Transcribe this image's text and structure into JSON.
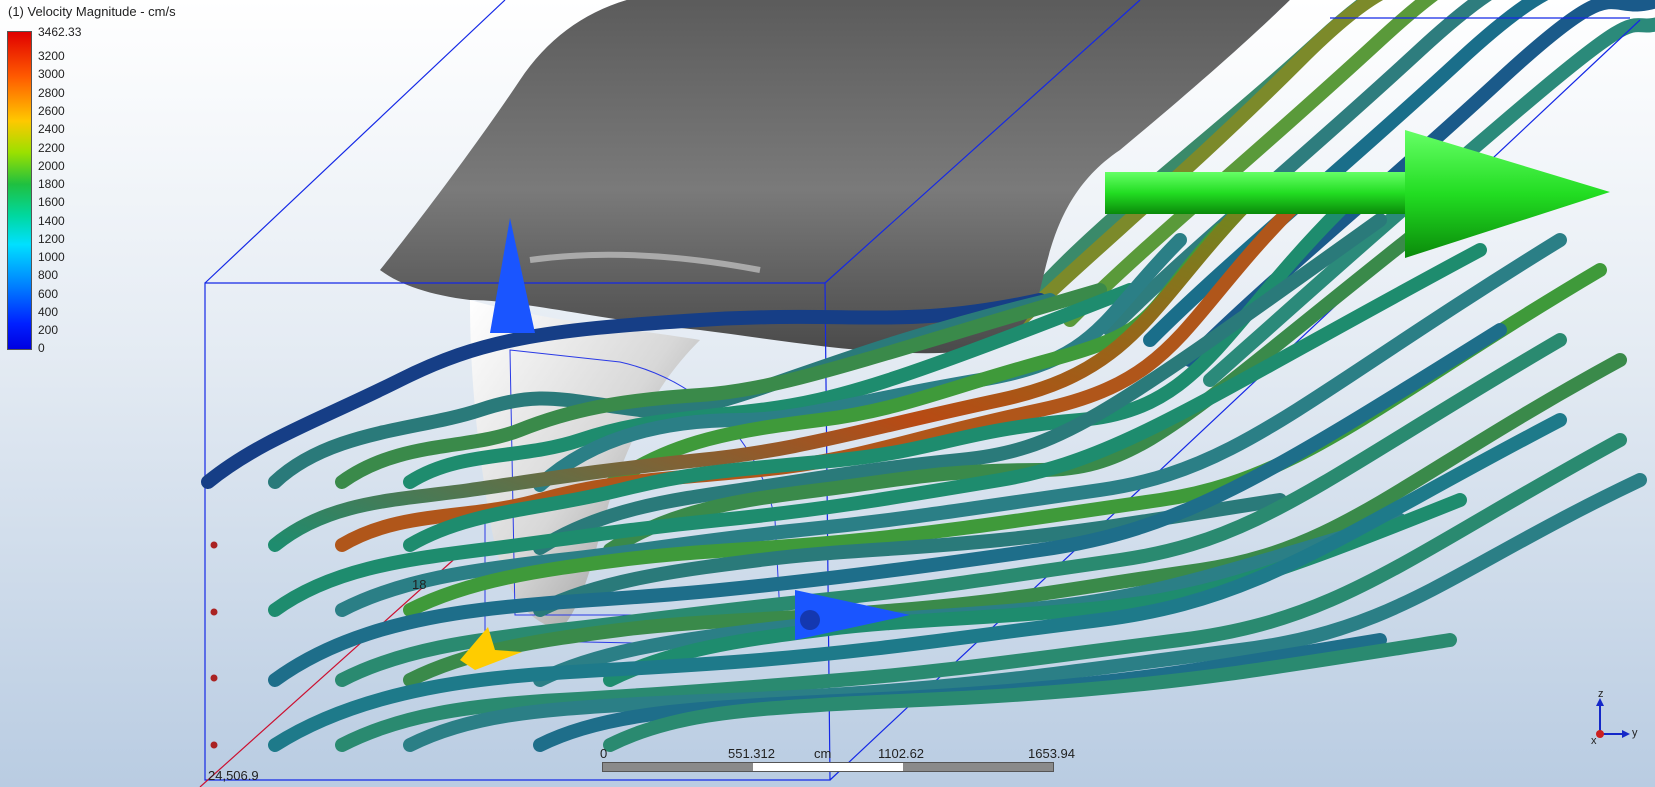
{
  "legend": {
    "title": "(1) Velocity Magnitude - cm/s",
    "max_label": "3462.33",
    "ticks": [
      "3200",
      "3000",
      "2800",
      "2600",
      "2400",
      "2200",
      "2000",
      "1800",
      "1600",
      "1400",
      "1200",
      "1000",
      "800",
      "600",
      "400",
      "200",
      "0"
    ]
  },
  "scale_bar": {
    "labels": [
      "0",
      "551.312",
      "cm",
      "1102.62",
      "1653.94"
    ]
  },
  "viewport_labels": {
    "bottom_left": "24,506.9",
    "axis_tick": "18"
  },
  "triad": {
    "z": "z",
    "y": "y",
    "x": "x"
  },
  "colors": {
    "background_top": "#ffffff",
    "background_bottom": "#b9cce2",
    "streamline_low": "#0a3d8f",
    "streamline_mid": "#1e8c6e",
    "streamline_high": "#c44a10",
    "bounding_box": "#1428e6",
    "flow_arrow": "#22dd22",
    "gizmo_z": "#1a55ff",
    "gizmo_y": "#1a55ff",
    "gizmo_x": "#ffcc00"
  },
  "icons": [
    "flow-direction-arrow-icon",
    "gizmo-z-arrow-icon",
    "gizmo-y-arrow-icon",
    "gizmo-x-arrow-icon",
    "axis-triad-icon"
  ]
}
